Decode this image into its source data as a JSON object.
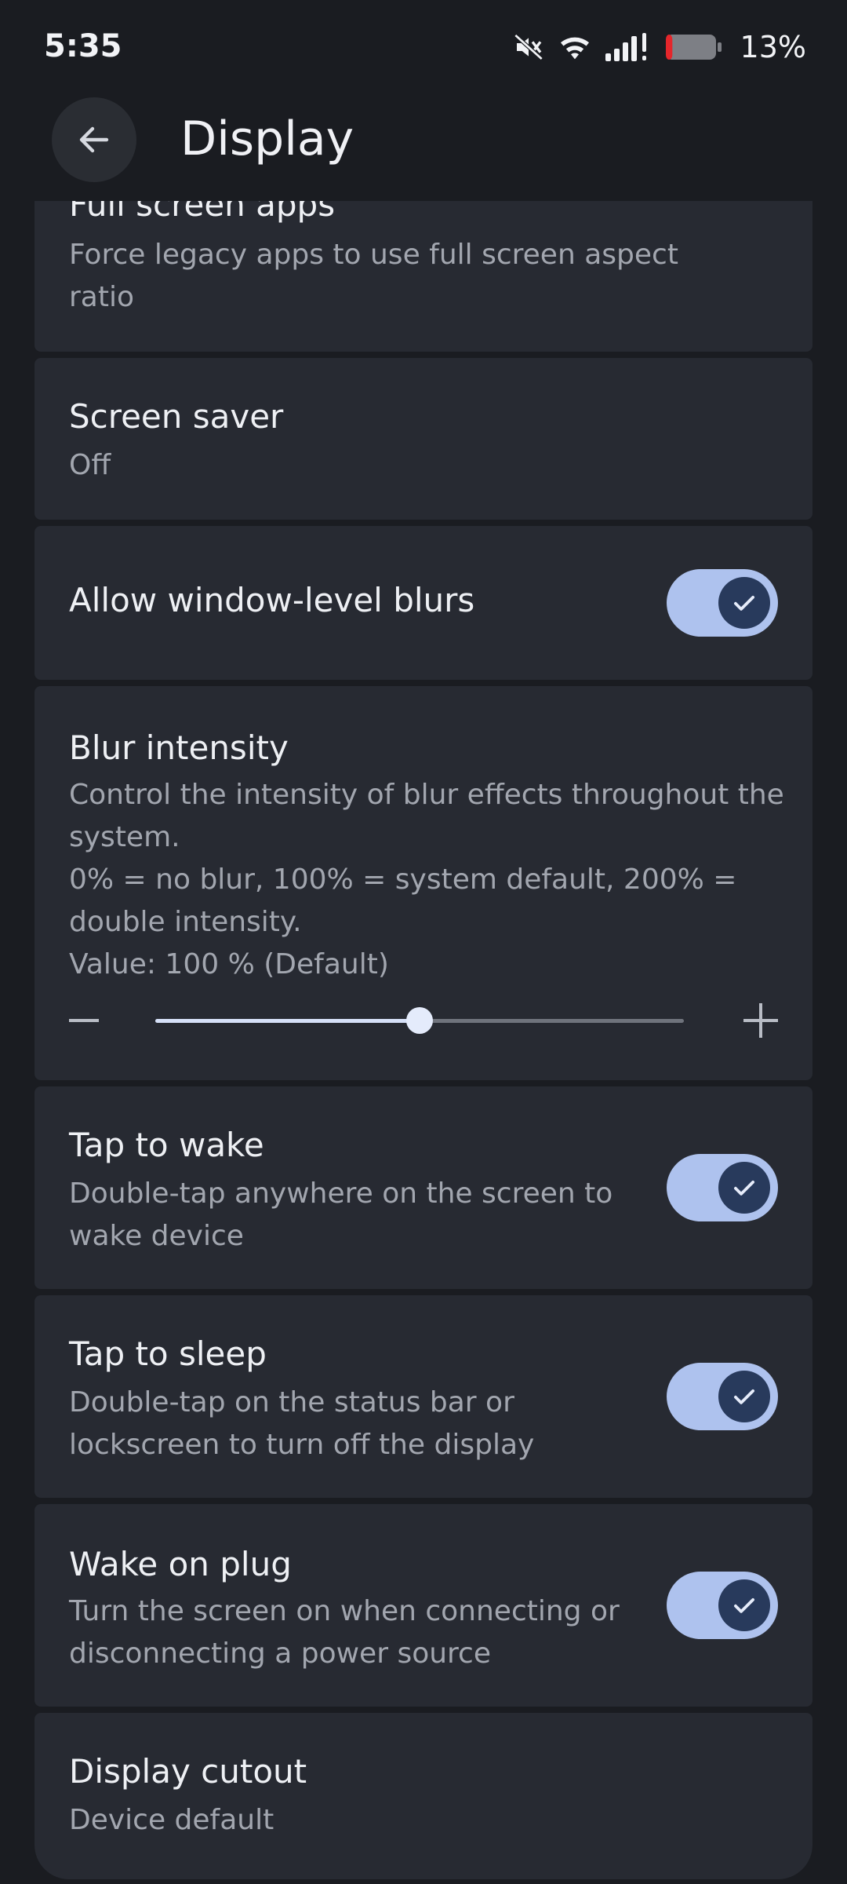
{
  "status_bar": {
    "time": "5:35",
    "battery_percent": "13%",
    "battery_level": 0.13,
    "icons": [
      "mute-icon",
      "wifi-icon",
      "signal-icon",
      "battery-icon"
    ]
  },
  "app_bar": {
    "title": "Display",
    "back_icon": "arrow-left-icon"
  },
  "settings": {
    "full_screen_apps": {
      "title": "Full screen apps",
      "subtitle": "Force legacy apps to use full screen aspect ratio"
    },
    "screen_saver": {
      "title": "Screen saver",
      "value": "Off"
    },
    "window_blurs": {
      "title": "Allow window-level blurs",
      "enabled": true
    },
    "blur_intensity": {
      "title": "Blur intensity",
      "description": "Control the intensity of blur effects throughout the system.",
      "scale_note": "0% = no blur, 100% = system default, 200% = double intensity.",
      "value_label": "Value: 100 % (Default)",
      "value_percent": 100,
      "min_percent": 0,
      "max_percent": 200
    },
    "tap_to_wake": {
      "title": "Tap to wake",
      "subtitle": "Double-tap anywhere on the screen to wake device",
      "enabled": true
    },
    "tap_to_sleep": {
      "title": "Tap to sleep",
      "subtitle": "Double-tap on the status bar or lockscreen to turn off the display",
      "enabled": true
    },
    "wake_on_plug": {
      "title": "Wake on plug",
      "subtitle": "Turn the screen on when connecting or disconnecting a power source",
      "enabled": true
    },
    "display_cutout": {
      "title": "Display cutout",
      "value": "Device default"
    }
  },
  "colors": {
    "background": "#1a1c21",
    "card": "#272a32",
    "toggle_track_on": "#aec2ee",
    "toggle_knob_on": "#283a5c"
  }
}
